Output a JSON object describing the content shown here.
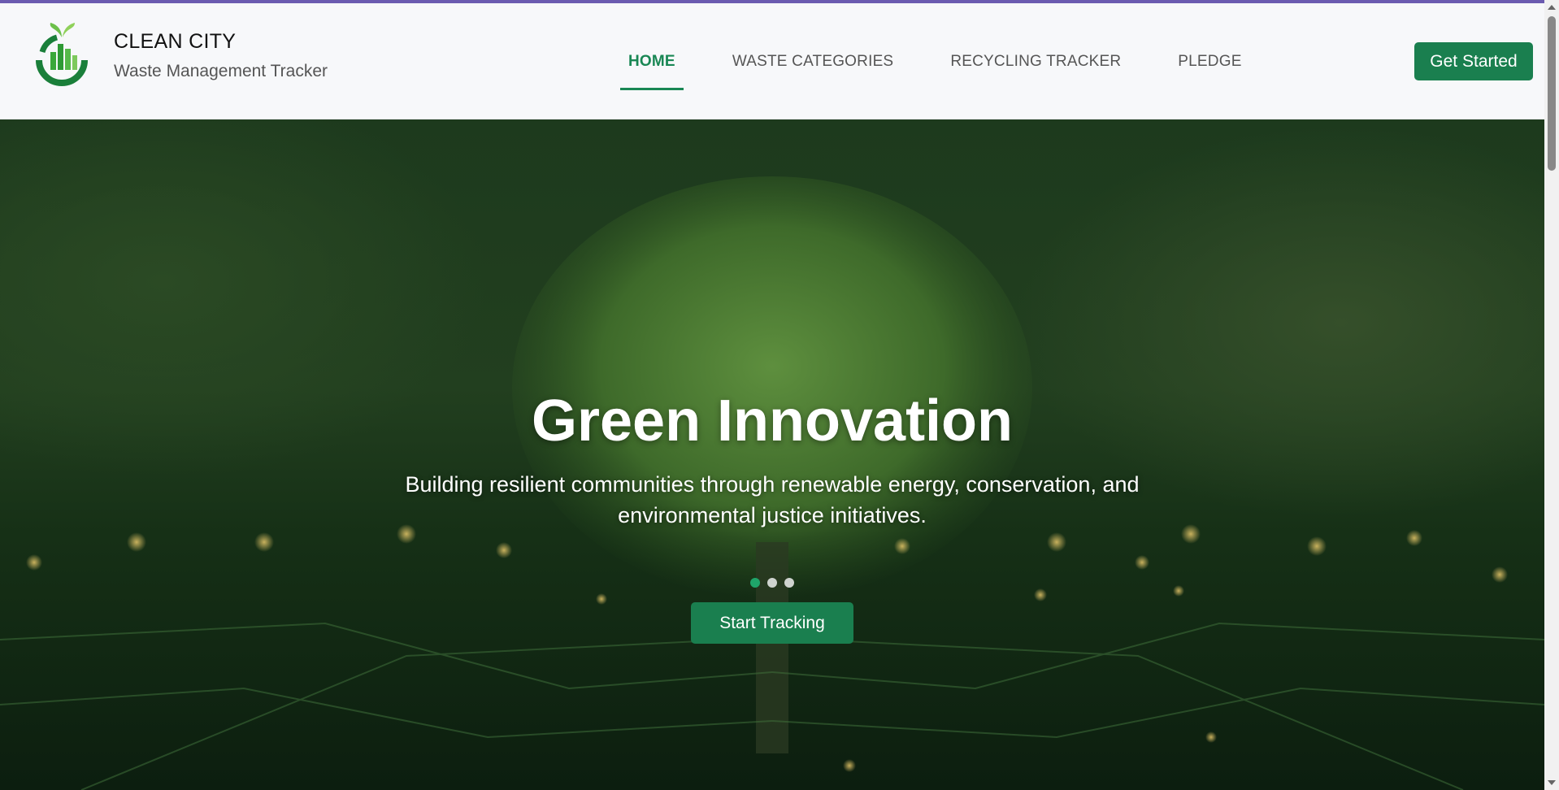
{
  "header": {
    "brand_title": "CLEAN CITY",
    "brand_subtitle": "Waste Management Tracker",
    "logo_icon": "recycling-building-leaf-icon",
    "nav": [
      {
        "label": "HOME",
        "active": true
      },
      {
        "label": "WASTE CATEGORIES",
        "active": false
      },
      {
        "label": "RECYCLING TRACKER",
        "active": false
      },
      {
        "label": "PLEDGE",
        "active": false
      }
    ],
    "cta_label": "Get Started"
  },
  "hero": {
    "title": "Green Innovation",
    "subtitle": "Building resilient communities through renewable energy, conservation, and environmental justice initiatives.",
    "slides_count": 3,
    "active_slide": 1,
    "button_label": "Start Tracking"
  },
  "colors": {
    "accent": "#198754",
    "button": "#1a7f4f",
    "top_bar": "#6b5bb0",
    "header_bg": "#f7f8fa"
  }
}
